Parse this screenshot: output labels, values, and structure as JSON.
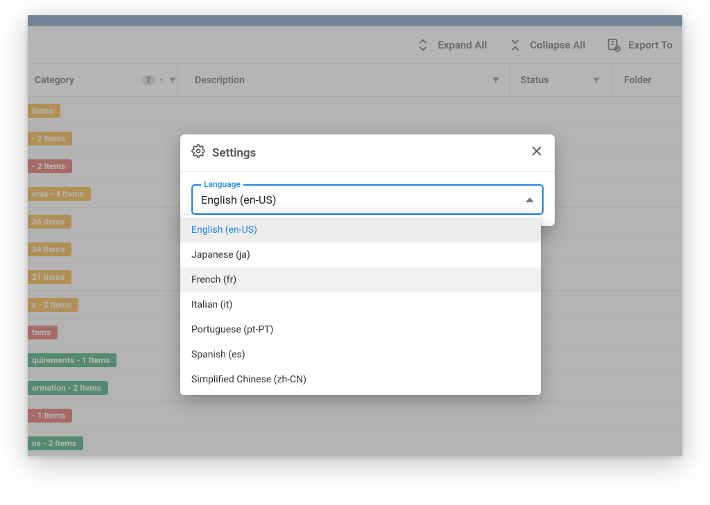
{
  "toolbar": {
    "expand_all": "Expand All",
    "collapse_all": "Collapse All",
    "export_to": "Export To"
  },
  "columns": {
    "category": "Category",
    "category_sort_badge": "2",
    "description": "Description",
    "status": "Status",
    "folder": "Folder"
  },
  "group_rows": [
    {
      "text": "Items",
      "color": "amber"
    },
    {
      "text": "- 2 Items",
      "color": "amber"
    },
    {
      "text": "- 2 Items",
      "color": "red"
    },
    {
      "text": "ents - 4 Items",
      "color": "amber"
    },
    {
      "text": "36 Items",
      "color": "amber"
    },
    {
      "text": "34 Items",
      "color": "amber"
    },
    {
      "text": "21 Items",
      "color": "amber"
    },
    {
      "text": "s - 2 Items",
      "color": "amber"
    },
    {
      "text": "tems",
      "color": "red"
    },
    {
      "text": "quirements - 1 Items",
      "color": "teal"
    },
    {
      "text": "ormation - 2 Items",
      "color": "teal"
    },
    {
      "text": "- 1 Items",
      "color": "red"
    },
    {
      "text": "ns - 2 Items",
      "color": "teal"
    }
  ],
  "dialog": {
    "title": "Settings",
    "field_label": "Language",
    "selected_value": "English (en-US)",
    "options": [
      "English (en-US)",
      "Japanese (ja)",
      "French (fr)",
      "Italian (it)",
      "Portuguese (pt-PT)",
      "Spanish (es)",
      "Simplified Chinese (zh-CN)"
    ]
  }
}
